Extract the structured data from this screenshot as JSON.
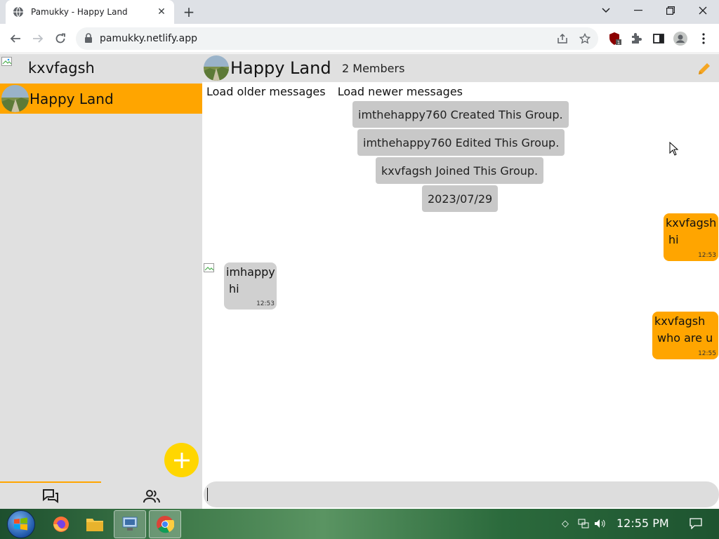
{
  "browser": {
    "tab_title": "Pamukky - Happy Land",
    "url": "pamukky.netlify.app",
    "new_tab_symbol": "+",
    "close_tab_symbol": "✕",
    "window_controls": {
      "chevron": "⌄",
      "minimize": "—",
      "restore": "❐",
      "close": "✕"
    }
  },
  "sidebar": {
    "username": "kxvfagsh",
    "chats": [
      {
        "name": "Happy Land",
        "selected": true
      }
    ],
    "fab_symbol": "+",
    "accent_color": "#ffa500",
    "fab_color": "#ffd600"
  },
  "chat": {
    "title": "Happy Land",
    "members": "2 Members",
    "load_older": "Load older messages",
    "load_newer": "Load newer messages",
    "system_messages": [
      "imthehappy760 Created This Group.",
      "imthehappy760 Edited This Group.",
      "kxvfagsh Joined This Group.",
      "2023/07/29"
    ],
    "messages": [
      {
        "sender": "kxvfagsh",
        "text": "hi",
        "time": "12:53",
        "mine": true
      },
      {
        "sender": "imhappy",
        "text": "hi",
        "time": "12:53",
        "mine": false
      },
      {
        "sender": "kxvfagsh",
        "text": "who are u",
        "time": "12:55",
        "mine": true
      }
    ]
  },
  "taskbar": {
    "clock": "12:55 PM"
  },
  "icons": [
    "globe-icon",
    "lock-icon",
    "share-icon",
    "star-icon",
    "shield-extension-icon",
    "puzzle-icon",
    "sidepanel-icon",
    "profile-icon",
    "kebab-menu-icon",
    "pencil-icon",
    "chats-icon",
    "contacts-icon",
    "windows-start-icon",
    "firefox-icon",
    "folder-icon",
    "network-app-icon",
    "chrome-icon"
  ]
}
